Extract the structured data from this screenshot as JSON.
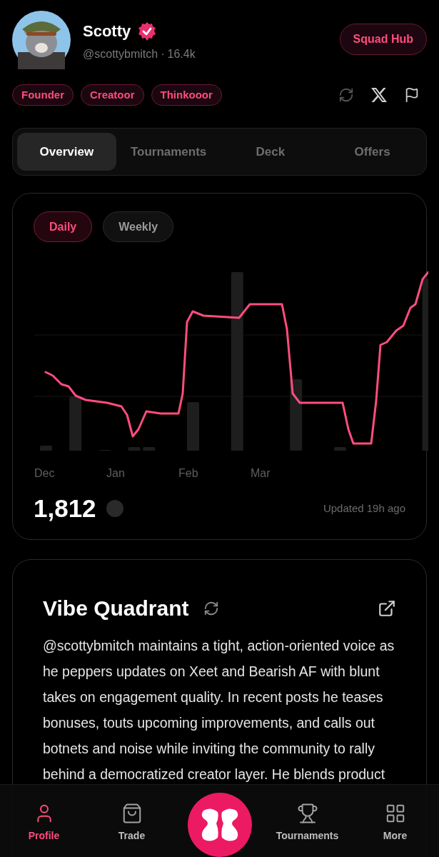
{
  "profile": {
    "name": "Scotty",
    "verified": true,
    "handle": "@scottybmitch",
    "separator": "·",
    "followers": "16.4k"
  },
  "squad_button": "Squad Hub",
  "tags": [
    "Founder",
    "Creatoor",
    "Thinkooor"
  ],
  "tabs": [
    {
      "label": "Overview",
      "selected": true
    },
    {
      "label": "Tournaments",
      "selected": false
    },
    {
      "label": "Deck",
      "selected": false
    },
    {
      "label": "Offers",
      "selected": false
    }
  ],
  "chart_card": {
    "periods": [
      {
        "label": "Daily",
        "selected": true
      },
      {
        "label": "Weekly",
        "selected": false
      }
    ],
    "months": [
      "Dec",
      "Jan",
      "Feb",
      "Mar"
    ],
    "total": "1,812",
    "updated": "Updated 19h ago"
  },
  "vibe": {
    "title": "Vibe Quadrant",
    "text": "@scottybmitch maintains a tight, action-oriented voice as he peppers updates on Xeet and Bearish AF with blunt takes on engagement quality. In recent posts he teases bonuses, touts upcoming improvements, and calls out botnets and noise while inviting the community to rally behind a democratized creator layer. He blends product"
  },
  "nav": [
    {
      "kind": "profile",
      "label": "Profile",
      "selected": true
    },
    {
      "kind": "trade",
      "label": "Trade",
      "selected": false
    },
    {
      "kind": "center"
    },
    {
      "kind": "tournaments",
      "label": "Tournaments",
      "selected": false
    },
    {
      "kind": "more",
      "label": "More",
      "selected": false
    }
  ]
}
